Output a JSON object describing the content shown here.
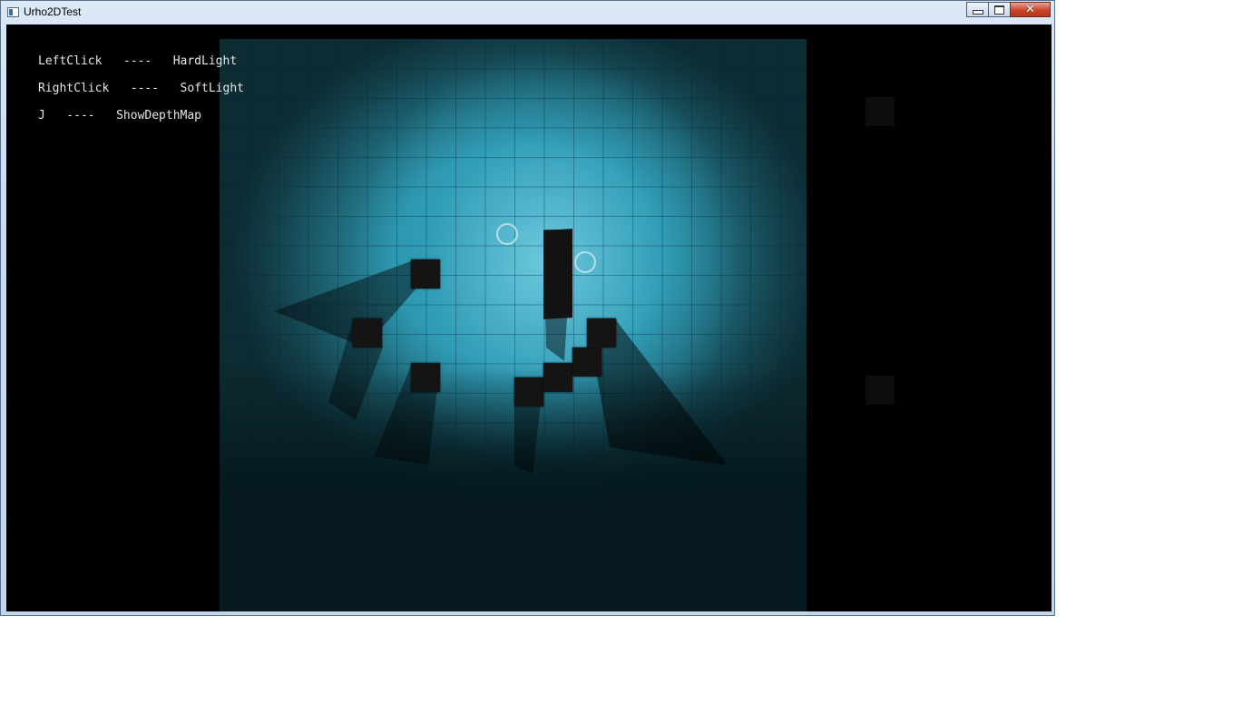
{
  "window": {
    "title": "Urho2DTest",
    "close_symbol": "✕"
  },
  "hud": {
    "lines": [
      "LeftClick   ----   HardLight",
      "RightClick   ----   SoftLight",
      "J   ----   ShowDepthMap"
    ]
  },
  "colors": {
    "tile_cyan": "#2a8fa6",
    "light_glow": "#82dcf0",
    "background": "#000000"
  }
}
